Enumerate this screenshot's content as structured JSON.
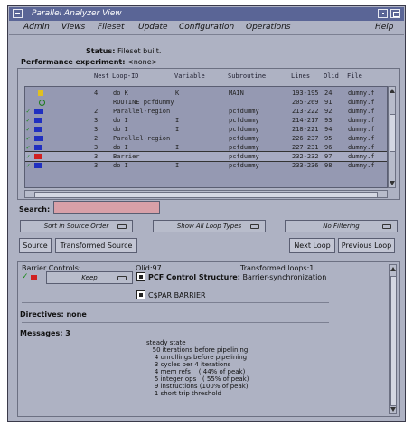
{
  "window": {
    "title": "Parallel Analyzer View"
  },
  "menu": [
    "Admin",
    "Views",
    "Fileset",
    "Update",
    "Configuration",
    "Operations",
    "Help"
  ],
  "status": {
    "label": "Status:",
    "value": "Fileset built."
  },
  "perf": {
    "label": "Performance experiment:",
    "value": "<none>"
  },
  "columns": [
    "Nest",
    "Loop-ID",
    "Variable",
    "Subroutine",
    "Lines",
    "Olid",
    "File"
  ],
  "loops": [
    {
      "icon": "loop-orange-icon",
      "check": "",
      "nest": "4",
      "loop": "do K",
      "var": "K",
      "sub": "MAIN",
      "lines": "193-195",
      "olid": "24",
      "file": "dummy.f"
    },
    {
      "icon": "routine-icon",
      "check": "",
      "nest": "",
      "loop": "ROUTINE pcfdummy",
      "var": "",
      "sub": "",
      "lines": "205-269",
      "olid": "91",
      "file": "dummy.f"
    },
    {
      "icon": "region-blue-icon",
      "check": "✓",
      "nest": "2",
      "loop": "Parallel-region",
      "var": "",
      "sub": "pcfdummy",
      "lines": "213-222",
      "olid": "92",
      "file": "dummy.f"
    },
    {
      "icon": "loop-blue-icon",
      "check": "✓",
      "nest": "3",
      "loop": "do I",
      "var": "I",
      "sub": "pcfdummy",
      "lines": "214-217",
      "olid": "93",
      "file": "dummy.f"
    },
    {
      "icon": "loop-blue-icon",
      "check": "✓",
      "nest": "3",
      "loop": "do I",
      "var": "I",
      "sub": "pcfdummy",
      "lines": "218-221",
      "olid": "94",
      "file": "dummy.f"
    },
    {
      "icon": "region-blue-icon",
      "check": "✓",
      "nest": "2",
      "loop": "Parallel-region",
      "var": "",
      "sub": "pcfdummy",
      "lines": "226-237",
      "olid": "95",
      "file": "dummy.f"
    },
    {
      "icon": "loop-blue-icon",
      "check": "✓",
      "nest": "3",
      "loop": "do I",
      "var": "I",
      "sub": "pcfdummy",
      "lines": "227-231",
      "olid": "96",
      "file": "dummy.f"
    },
    {
      "icon": "barrier-red-icon",
      "check": "✓",
      "nest": "3",
      "loop": "Barrier",
      "var": "",
      "sub": "pcfdummy",
      "lines": "232-232",
      "olid": "97",
      "file": "dummy.f"
    },
    {
      "icon": "loop-blue-icon",
      "check": "✓",
      "nest": "3",
      "loop": "do I",
      "var": "I",
      "sub": "pcfdummy",
      "lines": "233-236",
      "olid": "98",
      "file": "dummy.f"
    }
  ],
  "search": {
    "label": "Search:",
    "value": ""
  },
  "options": {
    "sort": "Sort in Source Order",
    "types": "Show All Loop Types",
    "filter": "No Filtering"
  },
  "buttons": {
    "source": "Source",
    "transformed": "Transformed Source",
    "next": "Next Loop",
    "previous": "Previous Loop"
  },
  "controls": {
    "barrier": "Barrier Controls:",
    "olid": "Olid:97",
    "transformed_loops": "Transformed loops:1",
    "keep": "Keep",
    "pcf_label": "PCF Control Structure:",
    "pcf_value": "Barrier-synchronization",
    "cspar": "C$PAR BARRIER"
  },
  "directives": "Directives: none",
  "messages": {
    "title": "Messages: 3",
    "lines": [
      "steady state",
      "   50 iterations before pipelining",
      "    4 unrollings before pipelining",
      "    3 cycles per 4 iterations",
      "    4 mem refs    ( 44% of peak)",
      "    5 integer ops   ( 55% of peak)",
      "    9 instructions (100% of peak)",
      "    1 short trip threshold"
    ]
  },
  "colors": {
    "title_bg": "#5a6596",
    "window_bg": "#aeb2c3",
    "list_bg": "#9599b2",
    "search_field": "#d8a0a8",
    "check": "#1a8a1a"
  }
}
